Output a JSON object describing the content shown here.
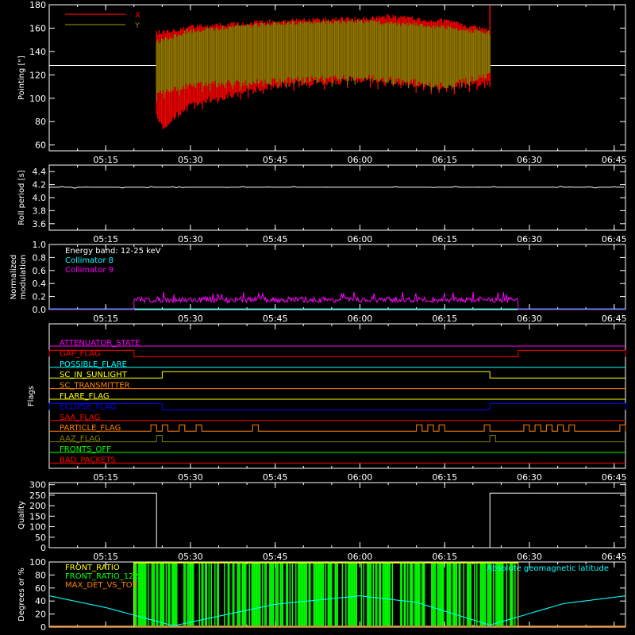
{
  "time_axis": {
    "xlim": [
      "05:05",
      "06:47"
    ],
    "ticks": [
      "05:15",
      "05:30",
      "05:45",
      "06:00",
      "06:15",
      "06:30",
      "06:45"
    ]
  },
  "chart_data": [
    {
      "type": "line",
      "ylabel": "Pointing [\"]",
      "ylim": [
        55,
        180
      ],
      "yticks": [
        60,
        80,
        100,
        120,
        140,
        160,
        180
      ],
      "reference_level": 128,
      "active_range": [
        "05:24",
        "06:23"
      ],
      "series": [
        {
          "name": "X",
          "color": "#ff0000",
          "upper_env": {
            "x": [
              "05:24",
              "05:30",
              "05:45",
              "06:00",
              "06:05",
              "06:15",
              "06:23"
            ],
            "y": [
              158,
              163,
              168,
              170,
              172,
              168,
              160
            ]
          },
          "lower_env": {
            "x": [
              "05:24",
              "05:25",
              "05:30",
              "05:45",
              "06:00",
              "06:15",
              "06:23"
            ],
            "y": [
              85,
              72,
              92,
              108,
              113,
              106,
              110
            ]
          }
        },
        {
          "name": "Y",
          "color": "#808000",
          "upper_env": {
            "x": [
              "05:24",
              "05:30",
              "05:45",
              "06:00",
              "06:15",
              "06:23"
            ],
            "y": [
              150,
              160,
              166,
              168,
              163,
              158
            ]
          },
          "lower_env": {
            "x": [
              "05:24",
              "05:30",
              "05:45",
              "06:00",
              "06:15",
              "06:23"
            ],
            "y": [
              100,
              108,
              112,
              115,
              108,
              116
            ]
          }
        }
      ]
    },
    {
      "type": "line",
      "ylabel": "Roll period [s]",
      "ylim": [
        3.5,
        4.5
      ],
      "yticks": [
        3.6,
        3.8,
        4.0,
        4.2,
        4.4
      ],
      "series": [
        {
          "name": "",
          "color": "#ffffff",
          "x": [
            "05:05",
            "06:47"
          ],
          "y": [
            4.16,
            4.16
          ]
        }
      ]
    },
    {
      "type": "line",
      "ylabel": "Normalized modulation",
      "ylim": [
        0,
        1
      ],
      "yticks": [
        0.0,
        0.2,
        0.4,
        0.6,
        0.8,
        1.0
      ],
      "legend": [
        "Energy band: 12-25 keV",
        "Collimator 8",
        "Collimator 9"
      ],
      "legend_colors": [
        "#ffffff",
        "#00ffff",
        "#ff00ff"
      ],
      "active_range": [
        "05:20",
        "06:28"
      ],
      "series": [
        {
          "name": "Collimator 8",
          "color": "#00ffff",
          "baseline": 0.01
        },
        {
          "name": "Collimator 9",
          "color": "#ff00ff",
          "mean": 0.15,
          "peak": 0.27
        }
      ]
    },
    {
      "type": "line",
      "ylabel": "Flags",
      "flags": [
        {
          "name": "ATTENUATOR_STATE",
          "color": "#ff00ff",
          "high": []
        },
        {
          "name": "GAP_FLAG",
          "color": "#ff0000",
          "high": [
            [
              "05:05",
              "05:20"
            ],
            [
              "06:28",
              "06:47"
            ]
          ]
        },
        {
          "name": "POSSIBLE_FLARE",
          "color": "#00ffff",
          "high": []
        },
        {
          "name": "SC_IN_SUNLIGHT",
          "color": "#ffff00",
          "high": [
            [
              "05:25",
              "06:23"
            ]
          ]
        },
        {
          "name": "SC_TRANSMITTER",
          "color": "#ff8000",
          "high": []
        },
        {
          "name": "FLARE_FLAG",
          "color": "#ffff00",
          "high": []
        },
        {
          "name": "ECLIPSE_FLAG",
          "color": "#0000ff",
          "high": [
            [
              "05:05",
              "05:25"
            ],
            [
              "06:23",
              "06:47"
            ]
          ]
        },
        {
          "name": "SAA_FLAG",
          "color": "#ff0000",
          "high": []
        },
        {
          "name": "PARTICLE_FLAG",
          "color": "#ff8000",
          "high": [
            [
              "05:23",
              "05:24"
            ],
            [
              "05:25",
              "05:26"
            ],
            [
              "05:28",
              "05:29"
            ],
            [
              "05:31",
              "05:32"
            ],
            [
              "05:41",
              "05:42"
            ],
            [
              "06:10",
              "06:11"
            ],
            [
              "06:12",
              "06:13"
            ],
            [
              "06:14",
              "06:15"
            ],
            [
              "06:22",
              "06:23"
            ],
            [
              "06:29",
              "06:30"
            ],
            [
              "06:31",
              "06:32"
            ],
            [
              "06:33",
              "06:34"
            ],
            [
              "06:35",
              "06:36"
            ],
            [
              "06:37",
              "06:38"
            ],
            [
              "06:46",
              "06:47"
            ]
          ]
        },
        {
          "name": "AAZ_FLAG",
          "color": "#808000",
          "high": [
            [
              "05:24",
              "05:25"
            ],
            [
              "06:23",
              "06:24"
            ]
          ]
        },
        {
          "name": "FRONTS_OFF",
          "color": "#00ff00",
          "high": []
        },
        {
          "name": "BAD_PACKETS",
          "color": "#ff0000",
          "high": []
        }
      ]
    },
    {
      "type": "line",
      "ylabel": "Quality",
      "ylim": [
        0,
        310
      ],
      "yticks": [
        0,
        50,
        100,
        150,
        200,
        250,
        300
      ],
      "series": [
        {
          "name": "",
          "color": "#ffffff",
          "x": [
            "05:05",
            "05:24",
            "05:24",
            "06:23",
            "06:23",
            "06:47"
          ],
          "y": [
            260,
            260,
            0,
            0,
            260,
            260
          ]
        }
      ]
    },
    {
      "type": "line",
      "ylabel": "Degrees or %",
      "ylim": [
        0,
        100
      ],
      "yticks": [
        0,
        20,
        40,
        60,
        80,
        100
      ],
      "legend": [
        "FRONT_RATIO",
        "FRONT_RATIO_1225",
        "MAX_DET_VS_TOT"
      ],
      "legend_colors": [
        "#ffff00",
        "#00ff00",
        "#ff8000"
      ],
      "annotation": "Absolute geomagnetic latitude",
      "annotation_color": "#00ffff",
      "active_range": [
        "05:20",
        "06:28"
      ],
      "series": [
        {
          "name": "Absolute geomagnetic latitude",
          "color": "#00ffff",
          "x": [
            "05:05",
            "05:15",
            "05:27",
            "05:45",
            "06:00",
            "06:10",
            "06:23",
            "06:36",
            "06:47"
          ],
          "y": [
            48,
            30,
            2,
            35,
            48,
            38,
            3,
            36,
            48
          ]
        },
        {
          "name": "FRONT_RATIO",
          "color": "#ffff00",
          "level": 100
        },
        {
          "name": "FRONT_RATIO_1225",
          "color": "#00ff00",
          "level": 100
        },
        {
          "name": "MAX_DET_VS_TOT",
          "color": "#ff8000",
          "level": 0
        }
      ]
    }
  ]
}
